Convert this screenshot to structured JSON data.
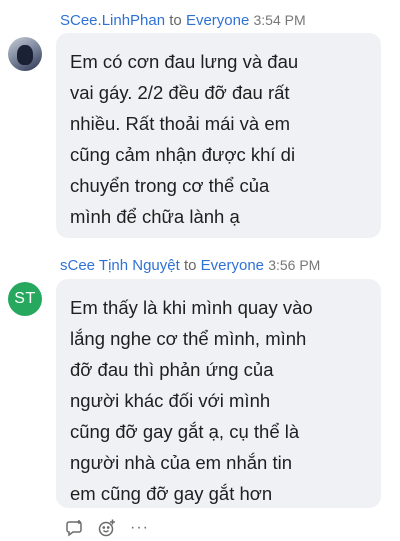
{
  "messages": [
    {
      "sender": "SCee.LinhPhan",
      "to_word": "to",
      "to_target": "Everyone",
      "time": "3:54 PM",
      "lines": [
        "Em có cơn đau lưng và đau",
        "vai gáy. 2/2 đều đỡ đau rất",
        "nhiều. Rất thoải mái và em",
        "cũng cảm nhận được khí di",
        "chuyển trong cơ thể của",
        "mình để chữa lành ạ"
      ]
    },
    {
      "sender": "sCee Tịnh Nguyệt",
      "to_word": "to",
      "to_target": "Everyone",
      "time": "3:56 PM",
      "avatar_initials": "ST",
      "avatar_color": "#27a85f",
      "lines": [
        "Em thấy là khi mình quay vào",
        "lắng nghe cơ thể mình, mình",
        "đỡ đau thì phản ứng của",
        "người khác đối với mình",
        "cũng đỡ gay gắt ạ, cụ thể là",
        "người nhà của em nhắn tin",
        "em cũng đỡ gay gắt hơn"
      ]
    }
  ],
  "actions": {
    "reply_icon": "comment-reply-icon",
    "react_icon": "add-reaction-icon",
    "more_label": "···"
  }
}
